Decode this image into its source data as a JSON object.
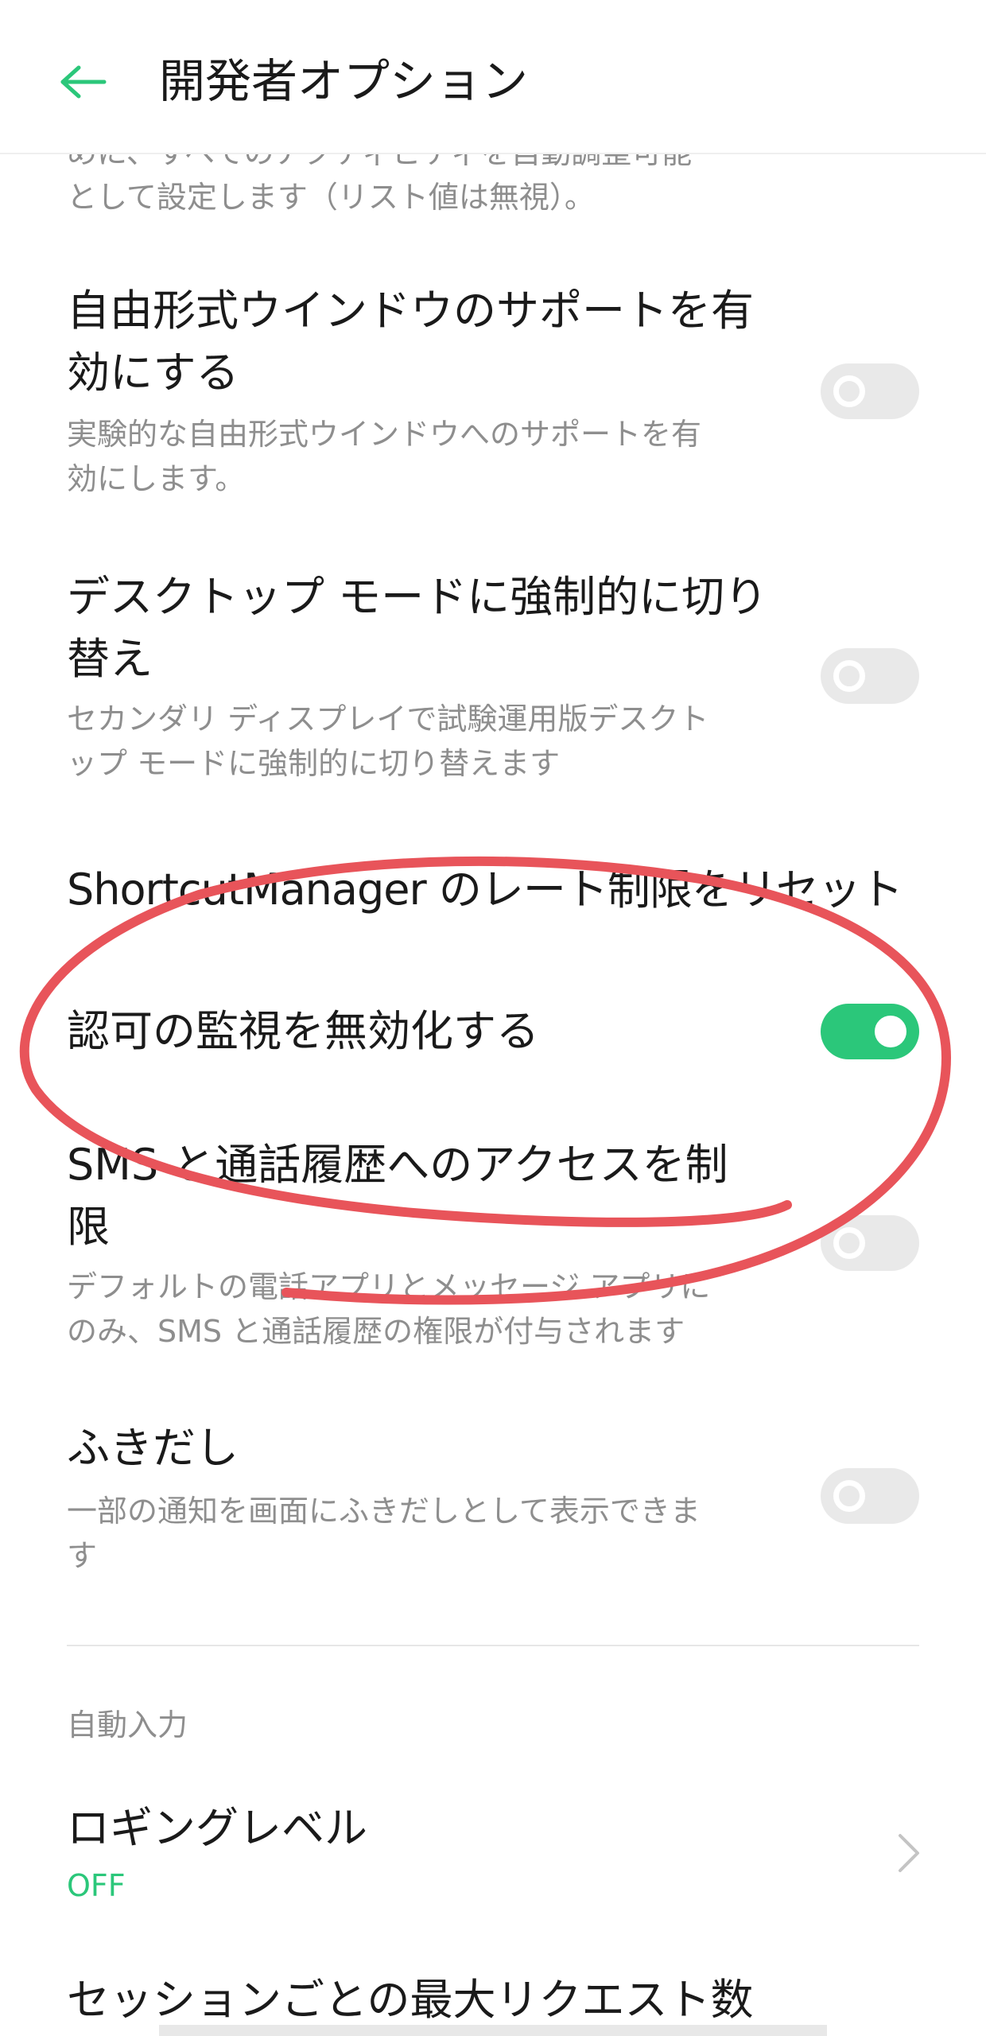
{
  "header": {
    "title": "開発者オプション",
    "back_icon": "arrow-left-icon",
    "accent_color": "#2bc77a"
  },
  "cut_description": {
    "line1": "めに、すべてのアクティビティを自動調整可能",
    "line2": "として設定します（リスト値は無視）。"
  },
  "items": [
    {
      "title_line1": "自由形式ウインドウのサポートを有",
      "title_line2": "効にする",
      "desc_line1": "実験的な自由形式ウインドウへのサポートを有",
      "desc_line2": "効にします。",
      "toggle_on": false
    },
    {
      "title_line1": "デスクトップ モードに強制的に切り",
      "title_line2": "替え",
      "desc_line1": "セカンダリ ディスプレイで試験運用版デスクト",
      "desc_line2": "ップ モードに強制的に切り替えます",
      "toggle_on": false
    },
    {
      "title_line1": "ShortcutManager のレート制限をリセット"
    },
    {
      "title_line1": "認可の監視を無効化する",
      "toggle_on": true
    },
    {
      "title_line1": "SMS と通話履歴へのアクセスを制",
      "title_line2": "限",
      "desc_line1": "デフォルトの電話アプリとメッセージ アプリに",
      "desc_line2": "のみ、SMS と通話履歴の権限が付与されます",
      "toggle_on": false
    },
    {
      "title_line1": "ふきだし",
      "desc_line1": "一部の通知を画面にふきだしとして表示できま",
      "desc_line2": "す",
      "toggle_on": false
    }
  ],
  "autofill_section": {
    "label": "自動入力",
    "logging": {
      "title": "ロギングレベル",
      "value": "OFF",
      "chevron_icon": "chevron-right-icon"
    },
    "max_requests_title": "セッションごとの最大リクエスト数"
  },
  "annotation": {
    "type": "hand-drawn red ellipse",
    "color": "#e8545a"
  }
}
